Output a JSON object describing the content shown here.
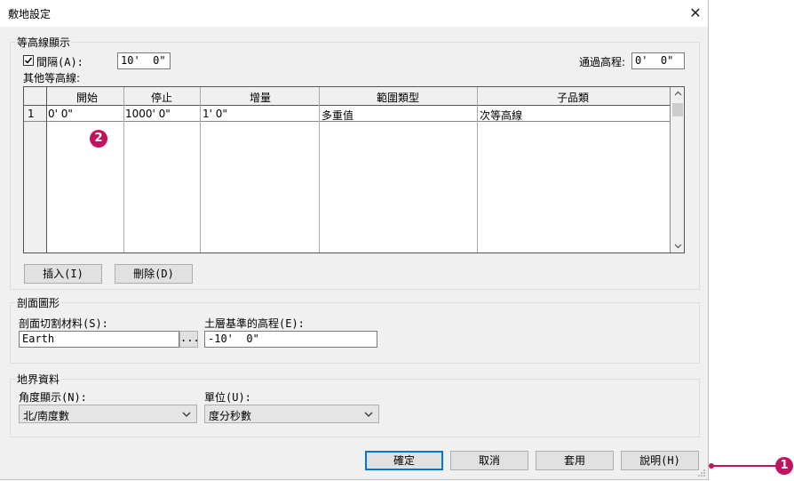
{
  "window": {
    "title": "敷地設定"
  },
  "contours": {
    "legend": "等高線顯示",
    "interval_label": "間隔(A):",
    "interval_value": "10'  0\"",
    "pass_label": "通過高程:",
    "pass_value": "0'  0\"",
    "other_label": "其他等高線:",
    "columns": [
      "開始",
      "停止",
      "增量",
      "範圍類型",
      "子品類"
    ],
    "rows": [
      {
        "num": "1",
        "cells": [
          "0' 0\"",
          "1000' 0\"",
          "1' 0\"",
          "多重值",
          "次等高線"
        ]
      }
    ],
    "insert_label": "插入(I)",
    "delete_label": "刪除(D)"
  },
  "section": {
    "legend": "剖面圖形",
    "material_label": "剖面切割材料(S):",
    "material_value": "Earth",
    "browse_label": "...",
    "elevation_label": "土層基準的高程(E):",
    "elevation_value": "-10'  0\""
  },
  "property": {
    "legend": "地界資料",
    "angle_label": "角度顯示(N):",
    "angle_value": "北/南度數",
    "units_label": "單位(U):",
    "units_value": "度分秒數"
  },
  "buttons": {
    "ok": "確定",
    "cancel": "取消",
    "apply": "套用",
    "help": "說明(H)"
  },
  "callouts": {
    "one": "1",
    "two": "2"
  },
  "colors": {
    "callout": "#c4135e",
    "default_button_border": "#0078d7"
  }
}
